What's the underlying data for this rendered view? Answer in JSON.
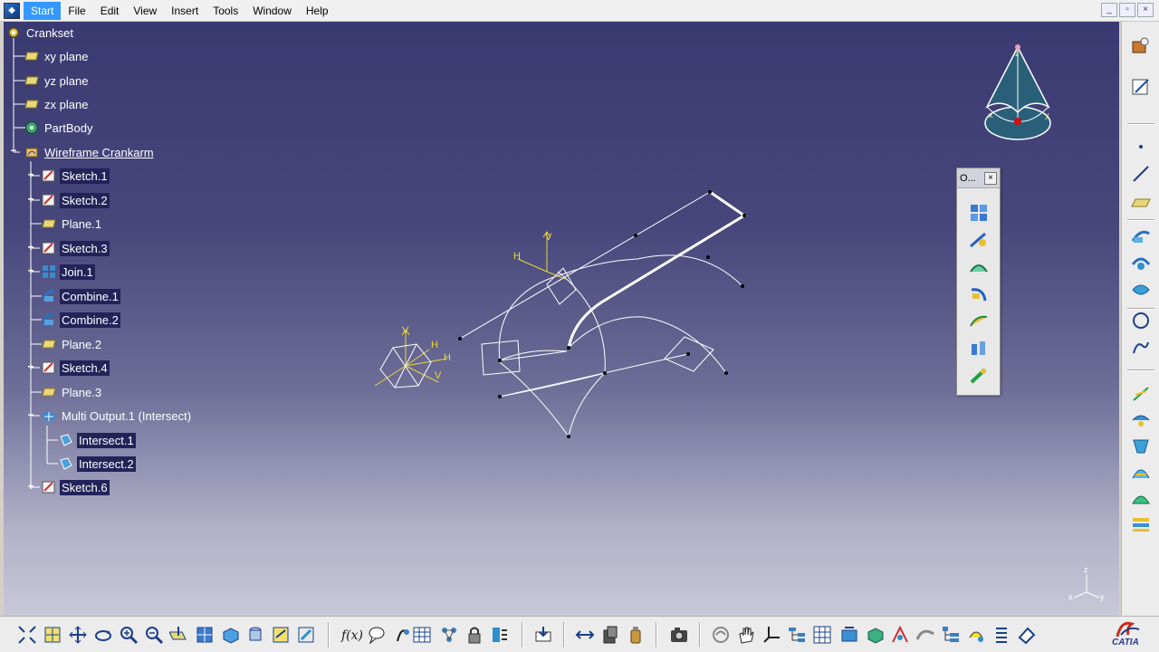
{
  "menubar": {
    "items": [
      {
        "label": "Start",
        "active": true
      },
      {
        "label": "File"
      },
      {
        "label": "Edit"
      },
      {
        "label": "View"
      },
      {
        "label": "Insert"
      },
      {
        "label": "Tools"
      },
      {
        "label": "Window"
      },
      {
        "label": "Help"
      }
    ],
    "window_controls": [
      "_",
      "▫",
      "×"
    ]
  },
  "tree": {
    "root": "Crankset",
    "nodes": [
      {
        "label": "xy plane",
        "icon": "plane-icon"
      },
      {
        "label": "yz plane",
        "icon": "plane-icon"
      },
      {
        "label": "zx plane",
        "icon": "plane-icon"
      },
      {
        "label": "PartBody",
        "icon": "gear-icon"
      },
      {
        "label": "Wireframe Crankarm",
        "icon": "geometric-set-icon"
      },
      {
        "label": "Sketch.1",
        "icon": "sketch-icon"
      },
      {
        "label": "Sketch.2",
        "icon": "sketch-icon"
      },
      {
        "label": "Plane.1",
        "icon": "plane-icon"
      },
      {
        "label": "Sketch.3",
        "icon": "sketch-icon"
      },
      {
        "label": "Join.1",
        "icon": "join-icon"
      },
      {
        "label": "Combine.1",
        "icon": "combine-icon"
      },
      {
        "label": "Combine.2",
        "icon": "combine-icon"
      },
      {
        "label": "Plane.2",
        "icon": "plane-icon"
      },
      {
        "label": "Sketch.4",
        "icon": "sketch-icon"
      },
      {
        "label": "Plane.3",
        "icon": "plane-icon"
      },
      {
        "label": "Multi Output.1 (Intersect)",
        "icon": "multi-output-icon"
      },
      {
        "label": "Intersect.1",
        "icon": "intersect-icon"
      },
      {
        "label": "Intersect.2",
        "icon": "intersect-icon"
      },
      {
        "label": "Sketch.6",
        "icon": "sketch-icon"
      }
    ]
  },
  "compass": {
    "labels": [
      "z",
      "x",
      "y"
    ]
  },
  "sketch_labels": {
    "h1": "H",
    "v1": "V",
    "h2": "H",
    "v2": "V",
    "h3": "H",
    "v3": "V"
  },
  "axis_triad": {
    "x": "x",
    "y": "y",
    "z": "z"
  },
  "floatbar": {
    "title": "O...",
    "close": "×"
  },
  "logo": {
    "text": "CATIA"
  },
  "colors": {
    "viewport_top": "#3a3a72",
    "viewport_bottom": "#c8c8d8",
    "geometry": "#ffffff",
    "sketch_axes": "#e8d838",
    "selection": "#23235a"
  }
}
